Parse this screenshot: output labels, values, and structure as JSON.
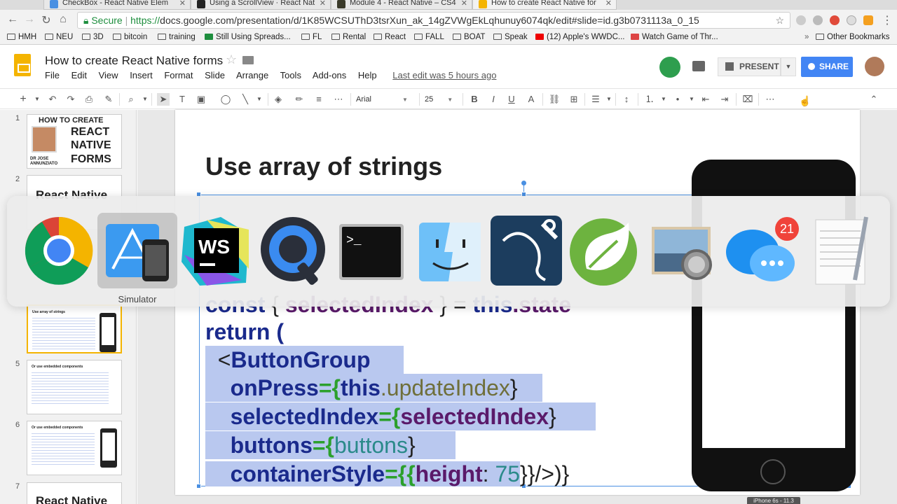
{
  "browser": {
    "tabs": [
      {
        "title": "CheckBox - React Native Elem",
        "favicon_color": "#4a90e2"
      },
      {
        "title": "Using a ScrollView · React Nat",
        "favicon_color": "#222222"
      },
      {
        "title": "Module 4 - React Native – CS4",
        "favicon_color": "#3a3a2a"
      },
      {
        "title": "How to create React Native for",
        "favicon_color": "#f4b400"
      }
    ],
    "url_secure": "Secure",
    "url_prefix": "https://",
    "url_rest": "docs.google.com/presentation/d/1K85WCSUThD3tsrXun_ak_14gZVWgEkLqhunuy6074qk/edit#slide=id.g3b0731113a_0_15",
    "bookmarks": [
      "HMH",
      "NEU",
      "3D",
      "bitcoin",
      "training",
      "Still Using Spreads...",
      "FL",
      "Rental",
      "React",
      "FALL",
      "BOAT",
      "Speak",
      "(12) Apple's WWDC...",
      "Watch Game of Thr..."
    ],
    "other_bookmarks": "Other Bookmarks"
  },
  "slides": {
    "doc_title": "How to create React Native forms",
    "menu": [
      "File",
      "Edit",
      "View",
      "Insert",
      "Format",
      "Slide",
      "Arrange",
      "Tools",
      "Add-ons",
      "Help"
    ],
    "last_edit": "Last edit was 5 hours ago",
    "present_label": "PRESENT",
    "share_label": "SHARE",
    "font_name": "Arial",
    "font_size": "25"
  },
  "filmstrip": [
    {
      "num": "1",
      "title_lines": [
        "HOW TO CREATE",
        "REACT",
        "NATIVE",
        "FORMS"
      ],
      "author": "DR JOSE ANNUNZIATO"
    },
    {
      "num": "2",
      "title": "React Native"
    },
    {
      "num": "",
      "title": "Use array of strings"
    },
    {
      "num": "5",
      "title": "Or use embedded components"
    },
    {
      "num": "6",
      "title": "Or use embedded components"
    },
    {
      "num": "7",
      "title": "React Native"
    }
  ],
  "slide": {
    "title": "Use array of strings",
    "code": {
      "l1_a": "const",
      "l1_b": " { ",
      "l1_c": "selectedIndex",
      "l1_d": " } = ",
      "l1_e": "this",
      "l1_f": ".state",
      "l2": "return (",
      "l3_a": "<",
      "l3_b": "ButtonGroup",
      "l4_a": "onPress",
      "l4_b": "={",
      "l4_c": "this",
      "l4_d": ".updateIndex",
      "l4_e": "}",
      "l5_a": "selectedIndex",
      "l5_b": "={",
      "l5_c": "selectedIndex",
      "l5_d": "}",
      "l6_a": "buttons",
      "l6_b": "={",
      "l6_c": "buttons",
      "l6_d": "}",
      "l7_a": "containerStyle",
      "l7_b": "={{",
      "l7_c": "height",
      "l7_d": ": ",
      "l7_e": "75",
      "l7_f": "}}/>)}"
    }
  },
  "phone_label": "iPhone 6s - 11.3",
  "switcher": {
    "apps": [
      "Google Chrome",
      "Simulator",
      "WebStorm",
      "QuickTime Player",
      "Terminal",
      "Finder",
      "MySQL Workbench",
      "Spring Tool Suite",
      "Preview",
      "Messages",
      "TextEdit"
    ],
    "selected_label": "Simulator",
    "messages_badge": "21"
  }
}
